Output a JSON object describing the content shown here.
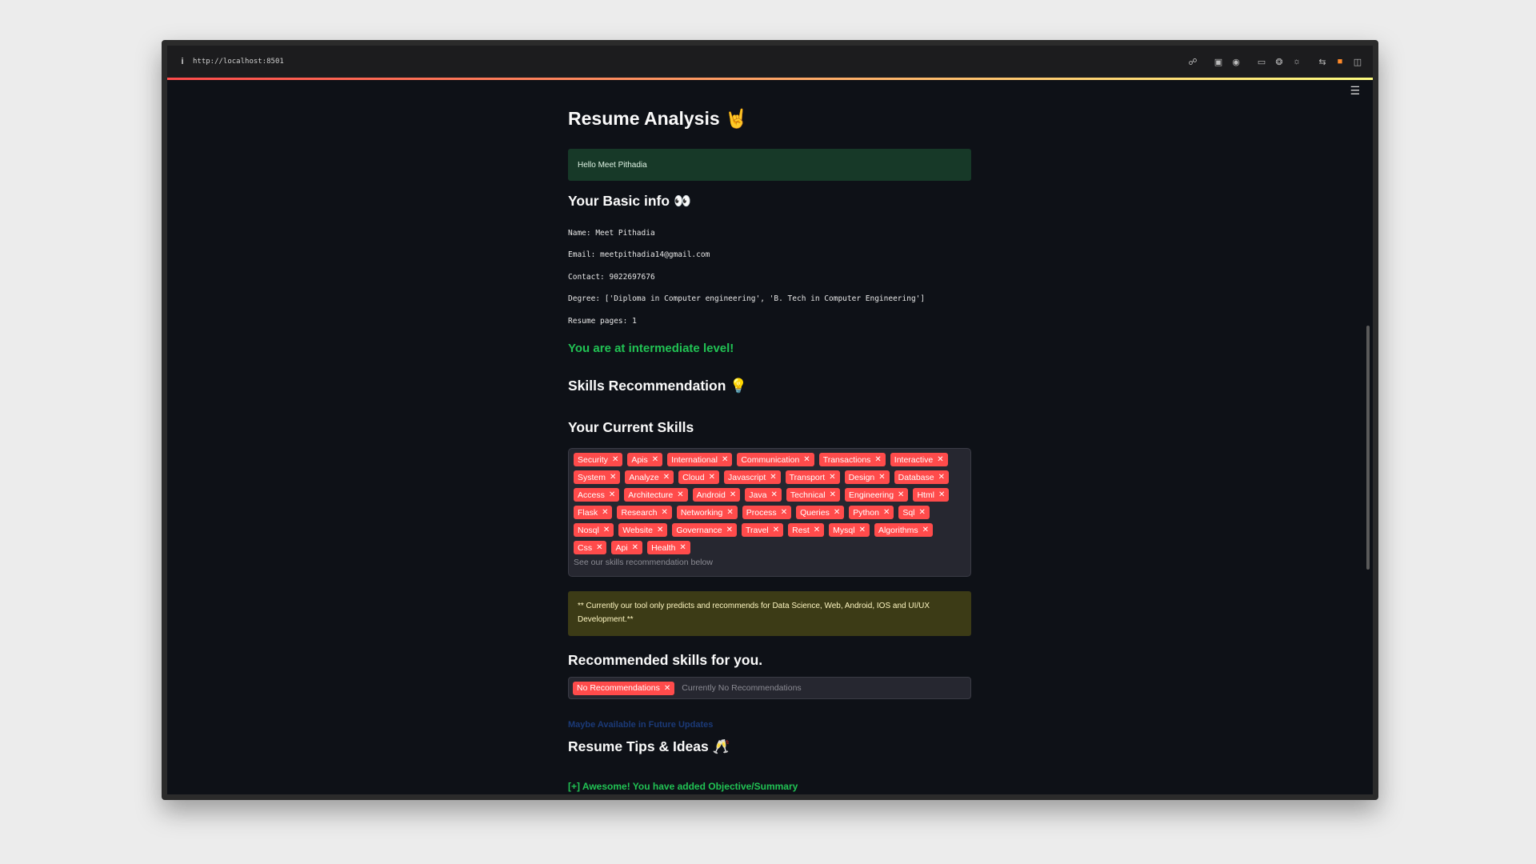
{
  "browser": {
    "url": "http://localhost:8501"
  },
  "page": {
    "title": "Resume Analysis",
    "title_emoji": "🤘",
    "hello": "Hello Meet Pithadia",
    "basic_info": {
      "heading": "Your Basic info",
      "heading_emoji": "👀",
      "name": "Name: Meet Pithadia",
      "email": "Email: meetpithadia14@gmail.com",
      "contact": "Contact: 9022697676",
      "degree": "Degree: ['Diploma in Computer engineering', 'B. Tech in Computer Engineering']",
      "pages": "Resume pages: 1"
    },
    "level": "You are at intermediate level!",
    "skills_heading": "Skills Recommendation",
    "skills_heading_emoji": "💡",
    "current_skills": {
      "heading": "Your Current Skills",
      "tags": [
        "Security",
        "Apis",
        "International",
        "Communication",
        "Transactions",
        "Interactive",
        "System",
        "Analyze",
        "Cloud",
        "Javascript",
        "Transport",
        "Design",
        "Database",
        "Access",
        "Architecture",
        "Android",
        "Java",
        "Technical",
        "Engineering",
        "Html",
        "Flask",
        "Research",
        "Networking",
        "Process",
        "Queries",
        "Python",
        "Sql",
        "Nosql",
        "Website",
        "Governance",
        "Travel",
        "Rest",
        "Mysql",
        "Algorithms",
        "Css",
        "Api",
        "Health"
      ],
      "placeholder": "See our skills recommendation below"
    },
    "warning": "** Currently our tool only predicts and recommends for Data Science, Web, Android, IOS and UI/UX Development.**",
    "recommended": {
      "heading": "Recommended skills for you.",
      "tag": "No Recommendations",
      "placeholder": "Currently No Recommendations",
      "future": "Maybe Available in Future Updates"
    },
    "tips": {
      "heading": "Resume Tips & Ideas",
      "heading_emoji": "🥂",
      "first": "[+] Awesome! You have added Objective/Summary"
    }
  },
  "colors": {
    "accent": "#ff4b4b",
    "success": "#21c354",
    "background": "#0e1117"
  }
}
